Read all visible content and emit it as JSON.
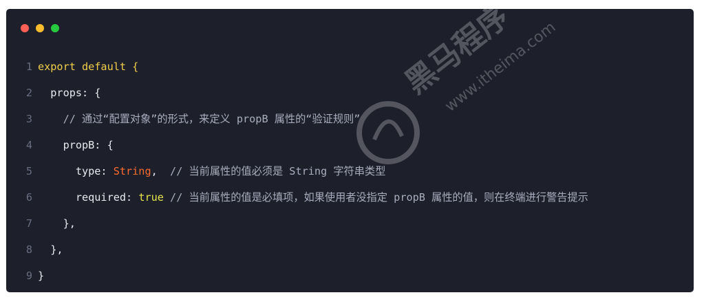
{
  "window": {
    "controls": [
      {
        "name": "close",
        "color": "#ff5f56"
      },
      {
        "name": "minimize",
        "color": "#ffbd2e"
      },
      {
        "name": "maximize",
        "color": "#27c93f"
      }
    ]
  },
  "code": {
    "lines": [
      {
        "number": "1",
        "tokens": [
          {
            "text": "export default {",
            "kind": "kw"
          }
        ]
      },
      {
        "number": "2",
        "tokens": [
          {
            "text": "  props: {",
            "kind": "key"
          }
        ]
      },
      {
        "number": "3",
        "tokens": [
          {
            "text": "    // 通过“配置对象”的形式，来定义 propB 属性的“验证规则”",
            "kind": "cmt"
          }
        ]
      },
      {
        "number": "4",
        "tokens": [
          {
            "text": "    propB: {",
            "kind": "key"
          }
        ]
      },
      {
        "number": "5",
        "tokens": [
          {
            "text": "      type: ",
            "kind": "key"
          },
          {
            "text": "String",
            "kind": "type"
          },
          {
            "text": ",  ",
            "kind": "punct"
          },
          {
            "text": "// 当前属性的值必须是 String 字符串类型",
            "kind": "cmt"
          }
        ]
      },
      {
        "number": "6",
        "tokens": [
          {
            "text": "      required: ",
            "kind": "key"
          },
          {
            "text": "true",
            "kind": "bool"
          },
          {
            "text": " ",
            "kind": "punct"
          },
          {
            "text": "// 当前属性的值是必填项，如果使用者没指定 propB 属性的值，则在终端进行警告提示",
            "kind": "cmt"
          }
        ]
      },
      {
        "number": "7",
        "tokens": [
          {
            "text": "    },",
            "kind": "punct"
          }
        ]
      },
      {
        "number": "8",
        "tokens": [
          {
            "text": "  },",
            "kind": "punct"
          }
        ]
      },
      {
        "number": "9",
        "tokens": [
          {
            "text": "}",
            "kind": "punct"
          }
        ]
      }
    ]
  },
  "watermark": {
    "brand_text": "黑马程序",
    "url_text": "www.itheima.com",
    "color": "#c8c8cc"
  }
}
